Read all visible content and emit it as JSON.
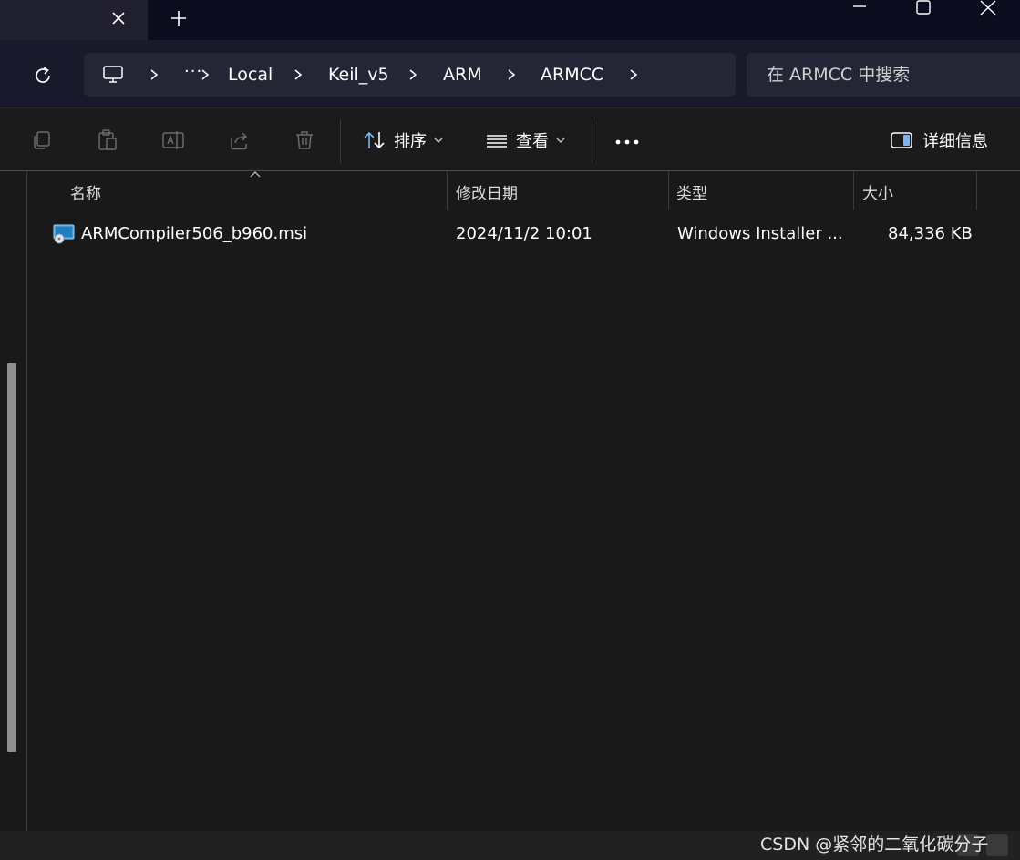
{
  "titlebar": {
    "tab_close_icon": "close-icon",
    "new_tab_icon": "plus-icon",
    "window_controls": [
      "minimize-icon",
      "maximize-icon",
      "close-icon"
    ]
  },
  "address": {
    "overflow": "···",
    "crumbs": [
      "Local",
      "Keil_v5",
      "ARM",
      "ARMCC"
    ]
  },
  "search": {
    "placeholder": "在 ARMCC 中搜索"
  },
  "commandbar": {
    "sort_label": "排序",
    "view_label": "查看",
    "details_label": "详细信息"
  },
  "columns": {
    "name": "名称",
    "modified": "修改日期",
    "type": "类型",
    "size": "大小"
  },
  "files": [
    {
      "name": "ARMCompiler506_b960.msi",
      "modified": "2024/11/2 10:01",
      "type": "Windows Installer ...",
      "size": "84,336 KB"
    }
  ],
  "watermark": "CSDN @紧邻的二氧化碳分子",
  "colors": {
    "background": "#191919",
    "titlebar": "#0b0d1e",
    "addressbar": "#181a2c",
    "field": "#242636",
    "scrollbar": "#8f8f8f"
  }
}
